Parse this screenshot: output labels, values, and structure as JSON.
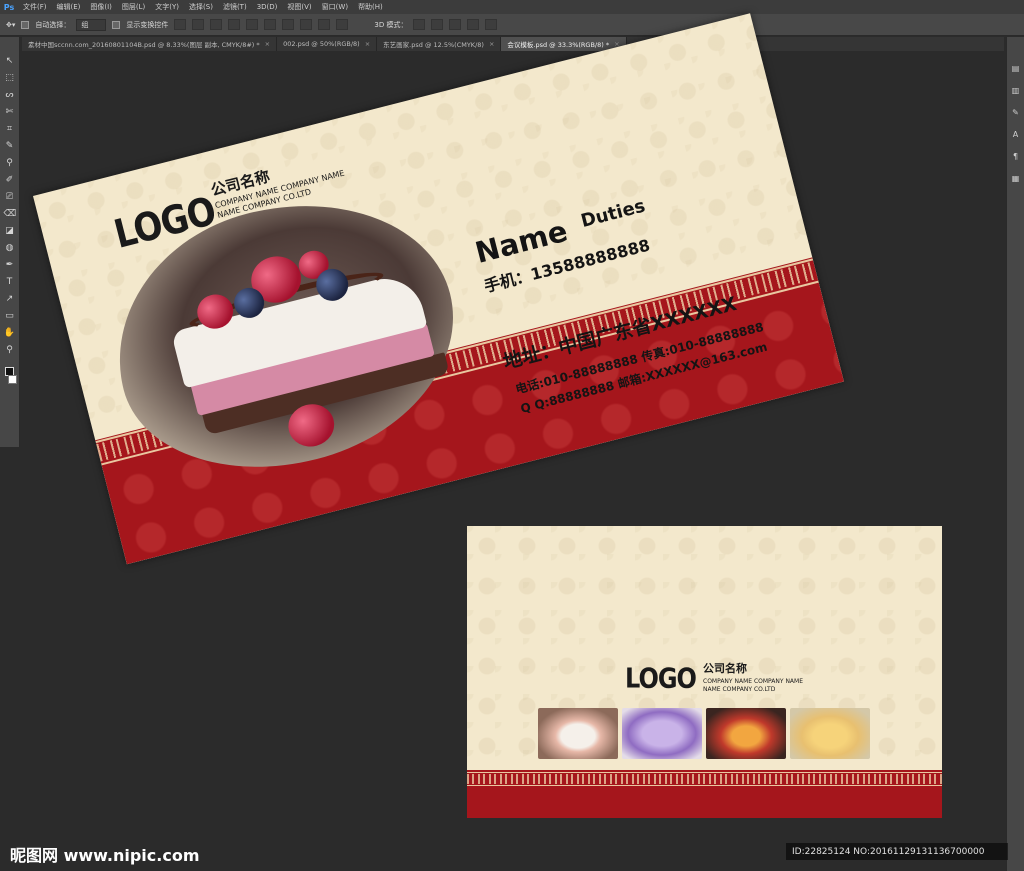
{
  "app": {
    "logo": "Ps",
    "menus": [
      "文件(F)",
      "编辑(E)",
      "图像(I)",
      "图层(L)",
      "文字(Y)",
      "选择(S)",
      "滤镜(T)",
      "3D(D)",
      "视图(V)",
      "窗口(W)",
      "帮助(H)"
    ]
  },
  "options": {
    "auto_select_label": "自动选择：",
    "auto_select_value": "组",
    "show_transform_label": "显示变换控件",
    "mode3d_label": "3D 模式："
  },
  "tabs": [
    {
      "label": "素材中国sccnn.com_20160801104B.psd @ 8.33%(图层 副本, CMYK/8#) *"
    },
    {
      "label": "002.psd @ 50%(RGB/8)"
    },
    {
      "label": "东艺画家.psd @ 12.5%(CMYK/8)"
    },
    {
      "label": "会议模板.psd @ 33.3%(RGB/8) *"
    }
  ],
  "tools": [
    "↖",
    "⬚",
    "ᔕ",
    "✄",
    "⌗",
    "✎",
    "⚲",
    "✐",
    "⎚",
    "⌫",
    "◪",
    "◍",
    "✒",
    "T",
    "↗",
    "▭",
    "✋",
    "⚲"
  ],
  "card_front": {
    "logo": "LOGO",
    "company_cn": "公司名称",
    "company_en_line1": "COMPANY NAME COMPANY NAME",
    "company_en_line2": "NAME COMPANY CO.LTD",
    "name": "Name",
    "duties": "Duties",
    "mobile": "手机：13588888888",
    "address": "地址：中国广东省XXXXXX",
    "contact_line1": "电话:010-88888888  传真:010-88888888",
    "contact_line2": "Q Q:88888888  邮箱:XXXXXX@163.com"
  },
  "card_back": {
    "logo": "LOGO",
    "company_cn": "公司名称",
    "company_en_line1": "COMPANY NAME COMPANY NAME",
    "company_en_line2": "NAME COMPANY CO.LTD"
  },
  "colors": {
    "card_bg": "#f3e8cc",
    "accent_red": "#a5161c",
    "canvas_bg": "#2b2b2b"
  },
  "watermark": {
    "site": "昵图网 www.nipic.com",
    "id_text": "ID:22825124 NO:20161129131136700000"
  }
}
